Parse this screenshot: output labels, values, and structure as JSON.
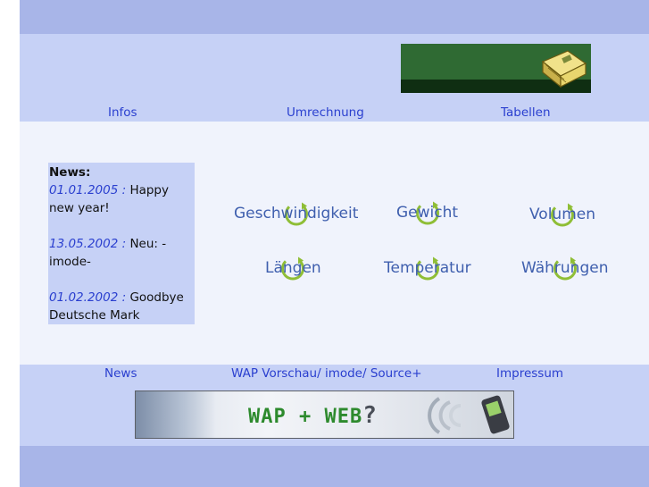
{
  "nav_top": {
    "infos": "Infos",
    "umrechnung": "Umrechnung",
    "tabellen": "Tabellen"
  },
  "news": {
    "title": "News:",
    "items": [
      {
        "date": "01.01.2005 :",
        "text": "Happy new year!"
      },
      {
        "date": "13.05.2002 :",
        "text": "Neu: - imode-"
      },
      {
        "date": "01.02.2002 :",
        "text": "Goodbye Deutsche Mark"
      }
    ]
  },
  "units": {
    "geschwindigkeit": "Geschwindigkeit",
    "gewicht": "Gewicht",
    "volumen": "Volumen",
    "laengen": "Längen",
    "temperatur": "Temperatur",
    "waehrungen": "Währungen"
  },
  "nav_bottom": {
    "news": "News",
    "wap_vorschau": "WAP Vorschau/ imode/ Source+",
    "impressum": "Impressum"
  },
  "banner": {
    "wap": "WAP",
    "plus": "+",
    "web": "WEB",
    "question": "?"
  },
  "colors": {
    "band_dark": "#a8b5e8",
    "band_light": "#c6d1f6",
    "content_bg": "#f0f3fc",
    "link_blue": "#2a3fcf",
    "unit_text": "#3f5fae",
    "swirl_green": "#8fbe36"
  }
}
